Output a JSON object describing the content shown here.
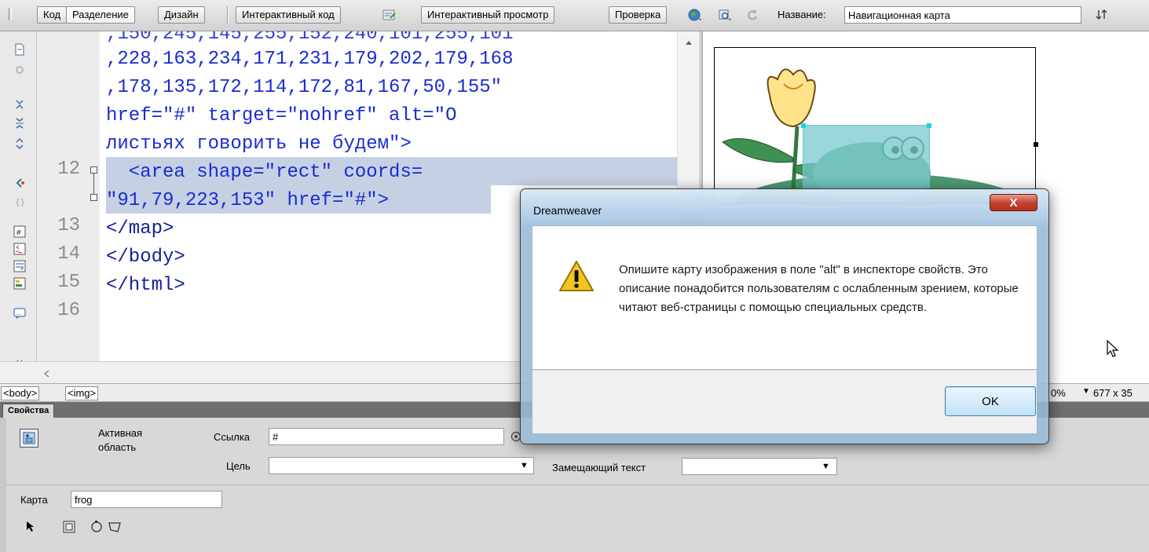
{
  "toolbar": {
    "code_label": "Код",
    "split_label": "Разделение",
    "design_label": "Дизайн",
    "live_code_label": "Интерактивный код",
    "live_view_label": "Интерактивный просмотр",
    "inspect_label": "Проверка",
    "title_label": "Название:",
    "title_value": "Навигационная карта"
  },
  "code": {
    "lines": [
      ",228,163,234,171,231,179,202,179,168",
      ",178,135,172,114,172,81,167,50,155\"",
      "href=\"#\" target=\"nohref\" alt=\"О",
      "листьях говорить не будем\">",
      "  <area shape=\"rect\" coords=",
      "\"91,79,223,153\" href=\"#\">",
      "</map>",
      "</body>",
      "</html>"
    ],
    "line_numbers": [
      "12",
      "13",
      "14",
      "15",
      "16"
    ]
  },
  "status": {
    "tags": [
      "<body>",
      "<img>"
    ],
    "zoom": "0%",
    "dimensions": "677 x 35"
  },
  "properties": {
    "tab_label": "Свойства",
    "hotspot_label": "Активная область",
    "link_label": "Ссылка",
    "link_value": "#",
    "target_label": "Цель",
    "target_value": "",
    "alt_label": "Замещающий текст",
    "alt_value": "",
    "map_label": "Карта",
    "map_value": "frog"
  },
  "dialog": {
    "title": "Dreamweaver",
    "close_label": "X",
    "message": "Опишите карту изображения в поле \"alt\" в инспекторе свойств. Это описание понадобится пользователям с ослабленным зрением, которые читают веб-страницы с помощью специальных средств.",
    "ok_label": "OK"
  },
  "colors": {
    "code_blue": "#1a2bd2",
    "selection": "#c5d1e3",
    "hotspot": "#78c8cd"
  }
}
